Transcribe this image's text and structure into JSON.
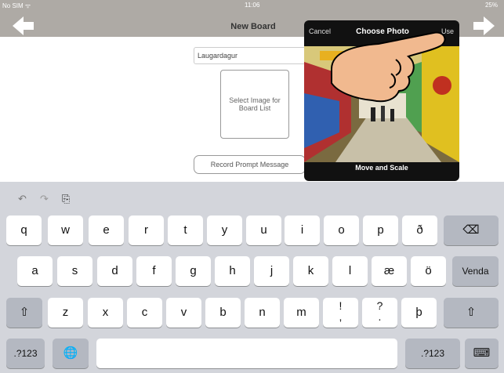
{
  "status_bar": {
    "carrier": "No SIM ᯤ",
    "time": "11:06",
    "battery": "25%"
  },
  "nav": {
    "title": "New Board"
  },
  "form": {
    "board_name_value": "Laugardagur",
    "select_image_label_line1": "Select Image for",
    "select_image_label_line2": "Board List",
    "record_button_label": "Record Prompt Message"
  },
  "photo_popover": {
    "cancel_label": "Cancel",
    "title": "Choose Photo",
    "use_label": "Use",
    "move_scale_label": "Move and Scale"
  },
  "keyboard": {
    "toolbar": {
      "undo_glyph": "↶",
      "redo_glyph": "↷",
      "paste_glyph": "⎘"
    },
    "row1": [
      "q",
      "w",
      "e",
      "r",
      "t",
      "y",
      "u",
      "i",
      "o",
      "p",
      "ð"
    ],
    "row1_backspace": "⌫",
    "row2": [
      "a",
      "s",
      "d",
      "f",
      "g",
      "h",
      "j",
      "k",
      "l",
      "æ",
      "ö"
    ],
    "row2_return": "Venda",
    "row3_shift": "⇧",
    "row3": [
      "z",
      "x",
      "c",
      "v",
      "b",
      "n",
      "m"
    ],
    "row3_punct": [
      {
        "top": "!",
        "bottom": ","
      },
      {
        "top": "?",
        "bottom": "."
      }
    ],
    "row3_extra": "þ",
    "row4_numbers_left": ".?123",
    "row4_globe": "🌐",
    "row4_numbers_right": ".?123",
    "row4_hide_keyboard": "⌨"
  },
  "colors": {
    "navbar": "#aeaaa5",
    "keyboard_bg": "#d3d5db",
    "dark_key": "#b4b8c1",
    "popover_bg": "#111111"
  }
}
